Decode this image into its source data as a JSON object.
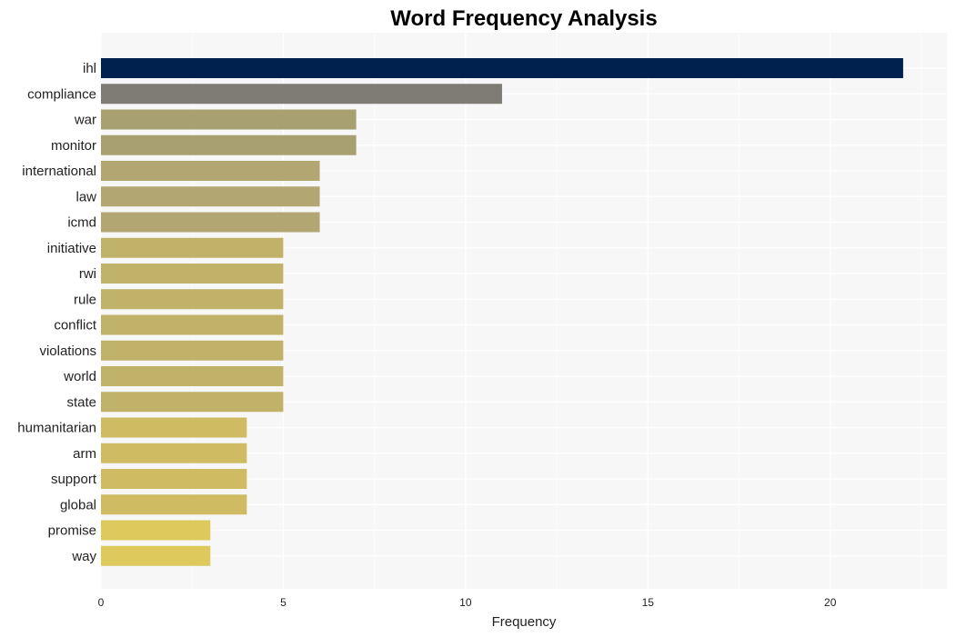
{
  "chart_data": {
    "type": "bar",
    "orientation": "horizontal",
    "title": "Word Frequency Analysis",
    "xlabel": "Frequency",
    "ylabel": "",
    "xlim": [
      0,
      23.2
    ],
    "xticks": [
      0,
      5,
      10,
      15,
      20
    ],
    "grid": true,
    "legend": null,
    "categories": [
      "ihl",
      "compliance",
      "war",
      "monitor",
      "international",
      "law",
      "icmd",
      "initiative",
      "rwi",
      "rule",
      "conflict",
      "violations",
      "world",
      "state",
      "humanitarian",
      "arm",
      "support",
      "global",
      "promise",
      "way"
    ],
    "values": [
      22,
      11,
      7,
      7,
      6,
      6,
      6,
      5,
      5,
      5,
      5,
      5,
      5,
      5,
      4,
      4,
      4,
      4,
      3,
      3
    ],
    "colors": [
      "#00204e",
      "#7f7c76",
      "#a8a071",
      "#a8a071",
      "#b2a772",
      "#b2a772",
      "#b2a772",
      "#c1b26a",
      "#c1b26a",
      "#c1b26a",
      "#c1b26a",
      "#c1b26a",
      "#c1b26a",
      "#c1b26a",
      "#cfbb62",
      "#cfbb62",
      "#cfbb62",
      "#cfbb62",
      "#dec95c",
      "#dec95c"
    ]
  }
}
